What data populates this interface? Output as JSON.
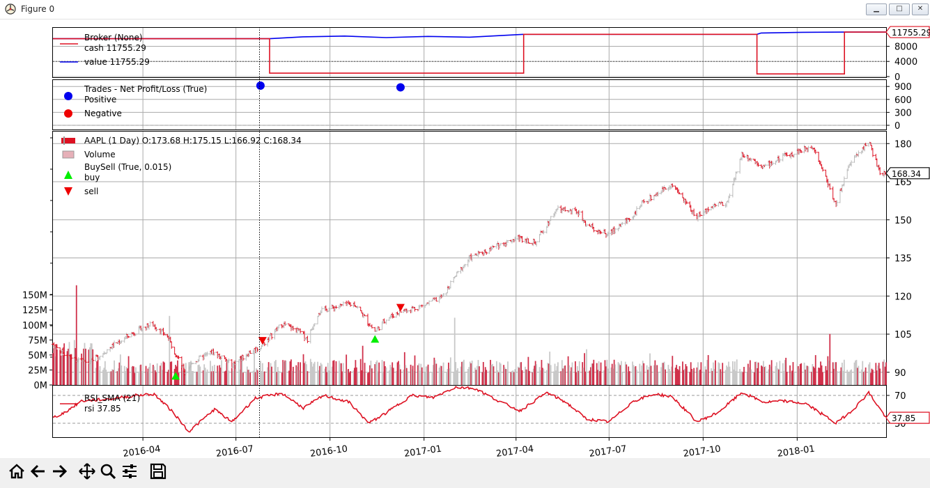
{
  "window": {
    "title": "Figure 0"
  },
  "toolbar": {
    "buttons": [
      "home-icon",
      "back-arrow-icon",
      "forward-arrow-icon",
      "pan-icon",
      "zoom-icon",
      "configure-subplots-icon",
      "save-icon"
    ]
  },
  "colors": {
    "red": "#dd1122",
    "blue": "#0000ee",
    "green": "#00ee00",
    "gray": "#bbbbbb",
    "grid": "#aaaaaa"
  },
  "broker": {
    "legend": {
      "title": "Broker (None)",
      "cash": "cash 11755.29",
      "value": "value 11755.29"
    },
    "ticks": [
      "8000",
      "4000",
      "0"
    ],
    "ylim": [
      0,
      12500
    ],
    "last_label": "11755.29",
    "cash": [
      [
        0,
        10000
      ],
      [
        0.26,
        10000
      ],
      [
        0.26,
        900
      ],
      [
        0.565,
        900
      ],
      [
        0.565,
        11160
      ],
      [
        0.845,
        11160
      ],
      [
        0.845,
        700
      ],
      [
        0.95,
        700
      ],
      [
        0.95,
        11755
      ],
      [
        1,
        11755
      ]
    ],
    "value": [
      [
        0,
        10000
      ],
      [
        0.26,
        10000
      ],
      [
        0.3,
        10500
      ],
      [
        0.35,
        10700
      ],
      [
        0.4,
        10300
      ],
      [
        0.45,
        10600
      ],
      [
        0.5,
        10400
      ],
      [
        0.565,
        11160
      ],
      [
        0.845,
        11160
      ],
      [
        0.85,
        11500
      ],
      [
        0.9,
        11700
      ],
      [
        0.95,
        11755
      ],
      [
        1,
        11755
      ]
    ]
  },
  "trades": {
    "legend": {
      "title": "Trades - Net Profit/Loss (True)",
      "positive": "Positive",
      "negative": "Negative"
    },
    "ticks": [
      "900",
      "600",
      "300",
      "0"
    ],
    "points": [
      {
        "date": "2016-07-25",
        "pnl": 920,
        "sign": "positive"
      },
      {
        "date": "2016-12-09",
        "pnl": 880,
        "sign": "positive"
      }
    ]
  },
  "price": {
    "legend": {
      "ohlc": "AAPL (1 Day) O:173.68 H:175.15 L:166.92 C:168.34",
      "volume": "Volume",
      "buysell": "BuySell (True, 0.015)",
      "buy": "buy",
      "sell": "sell"
    },
    "ticks": [
      "180",
      "165",
      "150",
      "135",
      "120",
      "105",
      "90"
    ],
    "volume_ticks": [
      "150M",
      "125M",
      "100M",
      "75M",
      "50M",
      "25M",
      "0M"
    ],
    "last_label": "168.34",
    "keypoints": [
      [
        "2016-01-04",
        101
      ],
      [
        "2016-01-20",
        96
      ],
      [
        "2016-02-10",
        94
      ],
      [
        "2016-03-01",
        100
      ],
      [
        "2016-03-20",
        105
      ],
      [
        "2016-04-10",
        109
      ],
      [
        "2016-04-25",
        104
      ],
      [
        "2016-05-12",
        90
      ],
      [
        "2016-05-20",
        94
      ],
      [
        "2016-06-08",
        98
      ],
      [
        "2016-06-27",
        93
      ],
      [
        "2016-07-15",
        98
      ],
      [
        "2016-07-25",
        100
      ],
      [
        "2016-08-15",
        109
      ],
      [
        "2016-09-01",
        106
      ],
      [
        "2016-09-09",
        103
      ],
      [
        "2016-09-20",
        114
      ],
      [
        "2016-10-10",
        116
      ],
      [
        "2016-10-25",
        117
      ],
      [
        "2016-11-14",
        106
      ],
      [
        "2016-11-25",
        111
      ],
      [
        "2016-12-09",
        114
      ],
      [
        "2016-12-30",
        116
      ],
      [
        "2017-01-20",
        120
      ],
      [
        "2017-02-01",
        128
      ],
      [
        "2017-02-15",
        135
      ],
      [
        "2017-03-15",
        140
      ],
      [
        "2017-04-03",
        143
      ],
      [
        "2017-04-20",
        141
      ],
      [
        "2017-05-10",
        154
      ],
      [
        "2017-06-01",
        153
      ],
      [
        "2017-06-09",
        148
      ],
      [
        "2017-06-30",
        144
      ],
      [
        "2017-07-25",
        152
      ],
      [
        "2017-08-04",
        157
      ],
      [
        "2017-08-31",
        164
      ],
      [
        "2017-09-25",
        151
      ],
      [
        "2017-10-12",
        156
      ],
      [
        "2017-10-25",
        157
      ],
      [
        "2017-11-08",
        176
      ],
      [
        "2017-11-30",
        171
      ],
      [
        "2017-12-20",
        175
      ],
      [
        "2018-01-17",
        179
      ],
      [
        "2018-02-08",
        156
      ],
      [
        "2018-02-20",
        171
      ],
      [
        "2018-03-12",
        181
      ],
      [
        "2018-03-23",
        168
      ],
      [
        "2018-03-29",
        168.34
      ]
    ],
    "buys": [
      {
        "date": "2016-05-03",
        "price": 88.5
      },
      {
        "date": "2016-11-14",
        "price": 103
      }
    ],
    "sells": [
      {
        "date": "2016-07-27",
        "price": 102.5
      },
      {
        "date": "2016-12-09",
        "price": 115.5
      }
    ],
    "volume_spikes": [
      {
        "date": "2016-01-27",
        "value": 133
      },
      {
        "date": "2016-04-27",
        "value": 115
      },
      {
        "date": "2017-01-31",
        "value": 112
      },
      {
        "date": "2018-02-02",
        "value": 85
      }
    ]
  },
  "rsi": {
    "legend": {
      "title": "RSI_SMA (21)",
      "value": "rsi 37.85"
    },
    "ticks": [
      "70",
      "30"
    ],
    "last_label": "37.85",
    "keypoints": [
      [
        "2016-01-04",
        38
      ],
      [
        "2016-01-15",
        45
      ],
      [
        "2016-02-01",
        62
      ],
      [
        "2016-03-01",
        65
      ],
      [
        "2016-03-25",
        70
      ],
      [
        "2016-04-12",
        72
      ],
      [
        "2016-05-01",
        45
      ],
      [
        "2016-05-16",
        18
      ],
      [
        "2016-06-10",
        50
      ],
      [
        "2016-06-27",
        32
      ],
      [
        "2016-07-20",
        66
      ],
      [
        "2016-08-15",
        73
      ],
      [
        "2016-09-05",
        52
      ],
      [
        "2016-09-25",
        70
      ],
      [
        "2016-10-20",
        60
      ],
      [
        "2016-11-08",
        30
      ],
      [
        "2016-11-25",
        45
      ],
      [
        "2016-12-20",
        70
      ],
      [
        "2017-01-10",
        67
      ],
      [
        "2017-02-01",
        82
      ],
      [
        "2017-02-20",
        80
      ],
      [
        "2017-03-15",
        62
      ],
      [
        "2017-04-05",
        48
      ],
      [
        "2017-05-01",
        74
      ],
      [
        "2017-05-20",
        60
      ],
      [
        "2017-06-09",
        36
      ],
      [
        "2017-07-01",
        32
      ],
      [
        "2017-07-25",
        62
      ],
      [
        "2017-08-15",
        72
      ],
      [
        "2017-09-01",
        68
      ],
      [
        "2017-09-25",
        32
      ],
      [
        "2017-10-15",
        45
      ],
      [
        "2017-11-08",
        74
      ],
      [
        "2017-11-30",
        60
      ],
      [
        "2017-12-20",
        62
      ],
      [
        "2018-01-10",
        58
      ],
      [
        "2018-02-08",
        30
      ],
      [
        "2018-02-25",
        50
      ],
      [
        "2018-03-12",
        74
      ],
      [
        "2018-03-29",
        37.85
      ]
    ]
  },
  "xaxis": {
    "start": "2016-01-04",
    "end": "2018-03-29",
    "ticks": [
      "2016-04",
      "2016-07",
      "2016-10",
      "2017-01",
      "2017-04",
      "2017-07",
      "2017-10",
      "2018-01"
    ]
  },
  "chart_data": [
    {
      "type": "line",
      "title": "Broker (None)",
      "series": [
        {
          "name": "cash 11755.29",
          "last": 11755.29
        },
        {
          "name": "value 11755.29",
          "last": 11755.29
        }
      ],
      "y_ticks": [
        8000,
        4000,
        0
      ]
    },
    {
      "type": "scatter",
      "title": "Trades - Net Profit/Loss (True)",
      "series": [
        {
          "name": "Positive",
          "x": [
            "2016-07-25",
            "2016-12-09"
          ],
          "y": [
            920,
            880
          ]
        },
        {
          "name": "Negative",
          "x": [],
          "y": []
        }
      ],
      "y_ticks": [
        900,
        600,
        300,
        0
      ]
    },
    {
      "type": "line",
      "title": "AAPL (1 Day) O:173.68 H:175.15 L:166.92 C:168.34",
      "open": 173.68,
      "high": 175.15,
      "low": 166.92,
      "close": 168.34,
      "ylim": [
        85,
        185
      ],
      "y_ticks": [
        180,
        165,
        150,
        135,
        120,
        105,
        90
      ],
      "volume_ticks": [
        "150M",
        "125M",
        "100M",
        "75M",
        "50M",
        "25M",
        "0M"
      ]
    },
    {
      "type": "line",
      "title": "RSI_SMA (21)",
      "series": [
        {
          "name": "rsi 37.85",
          "last": 37.85
        }
      ],
      "y_ticks": [
        70,
        30
      ]
    }
  ]
}
